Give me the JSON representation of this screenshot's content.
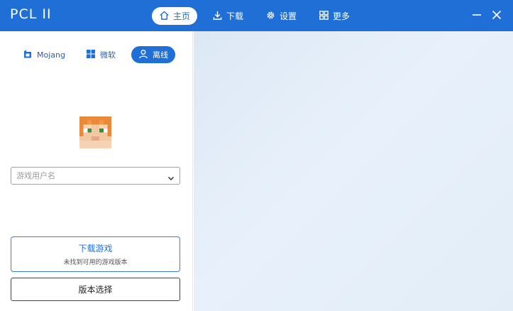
{
  "app": {
    "title": "PCL II"
  },
  "nav": {
    "items": [
      {
        "label": "主页",
        "icon": "home-icon",
        "active": true
      },
      {
        "label": "下载",
        "icon": "download-icon",
        "active": false
      },
      {
        "label": "设置",
        "icon": "gear-icon",
        "active": false
      },
      {
        "label": "更多",
        "icon": "grid-icon",
        "active": false
      }
    ]
  },
  "window": {
    "controls": [
      "minimize-icon",
      "close-icon"
    ]
  },
  "login": {
    "modes": [
      {
        "label": "Mojang",
        "icon": "mojang-icon",
        "active": false
      },
      {
        "label": "微软",
        "icon": "windows-icon",
        "active": false
      },
      {
        "label": "离线",
        "icon": "user-icon",
        "active": true
      }
    ],
    "username_placeholder": "游戏用户名",
    "username_value": ""
  },
  "actions": {
    "download_title": "下载游戏",
    "download_subtitle": "未找到可用的游戏版本",
    "version_select": "版本选择"
  },
  "colors": {
    "accent": "#1f6fd6",
    "titlebar": "#1f6fd6",
    "main_bg": "#e3edf8"
  }
}
